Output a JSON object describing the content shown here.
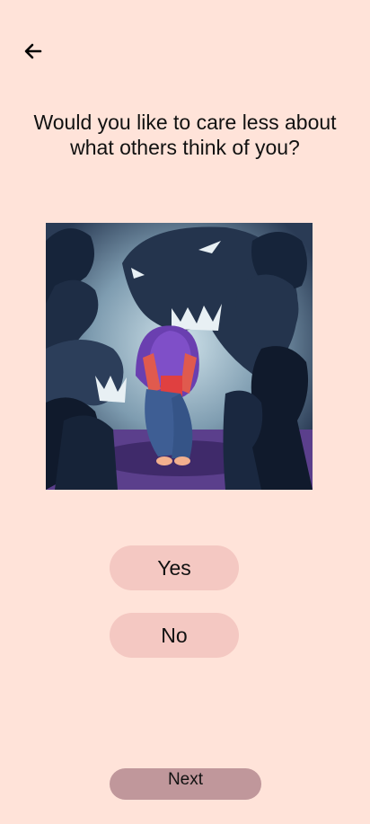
{
  "question": {
    "line1": "Would you like to care less about",
    "line2": "what others think of you?"
  },
  "options": {
    "yes_label": "Yes",
    "no_label": "No"
  },
  "next_label": "Next",
  "colors": {
    "background": "#FFE3D9",
    "option_button": "#F4C8C2",
    "next_button": "#C0979B"
  }
}
